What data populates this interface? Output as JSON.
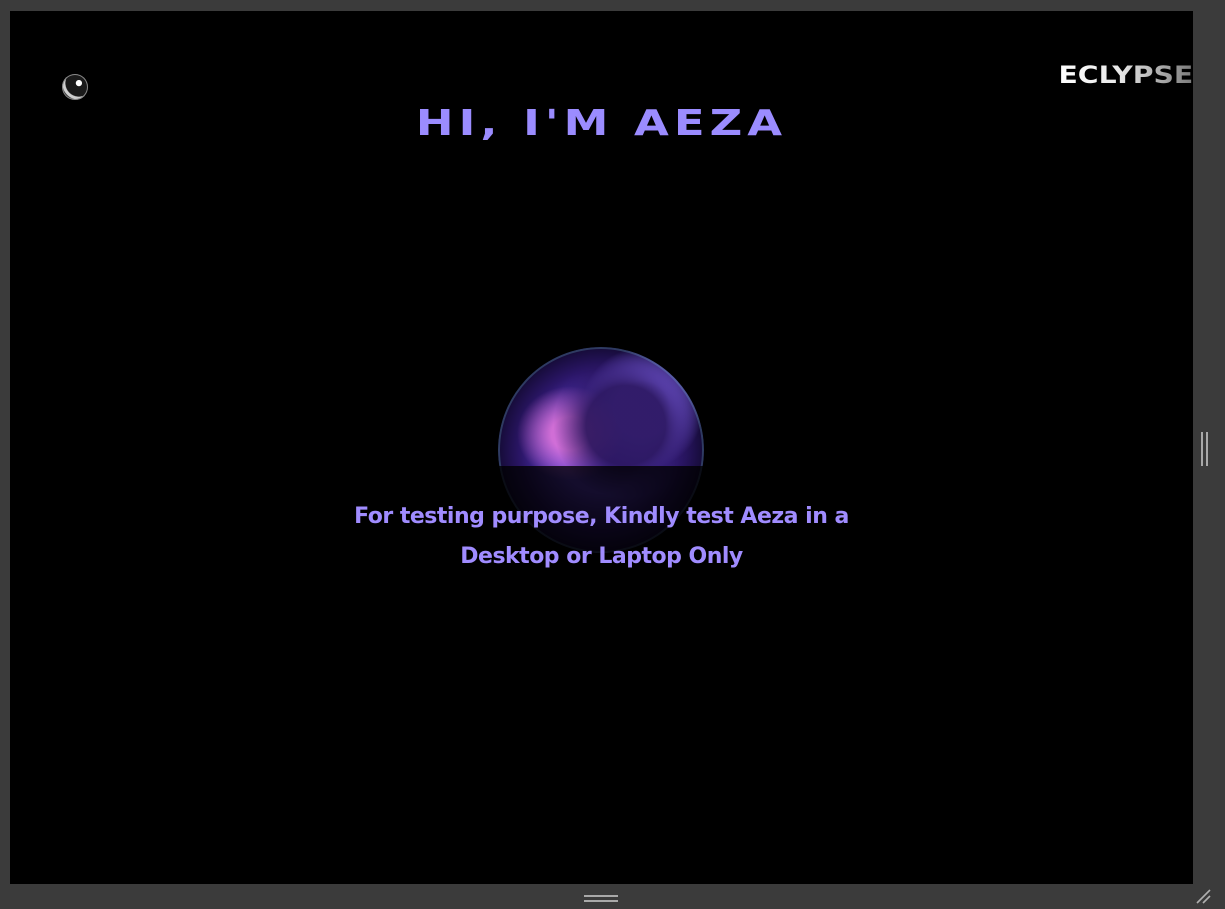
{
  "header": {
    "brand": "ECLYPSE",
    "logo_icon": "orb-icon"
  },
  "hero": {
    "headline": "HI, I'M AEZA"
  },
  "notice": {
    "line1": "For testing purpose, Kindly test Aeza in a",
    "line2": "Desktop or Laptop Only"
  },
  "colors": {
    "accent": "#9b8cff",
    "background": "#000000",
    "frame": "#3b3b3b"
  }
}
